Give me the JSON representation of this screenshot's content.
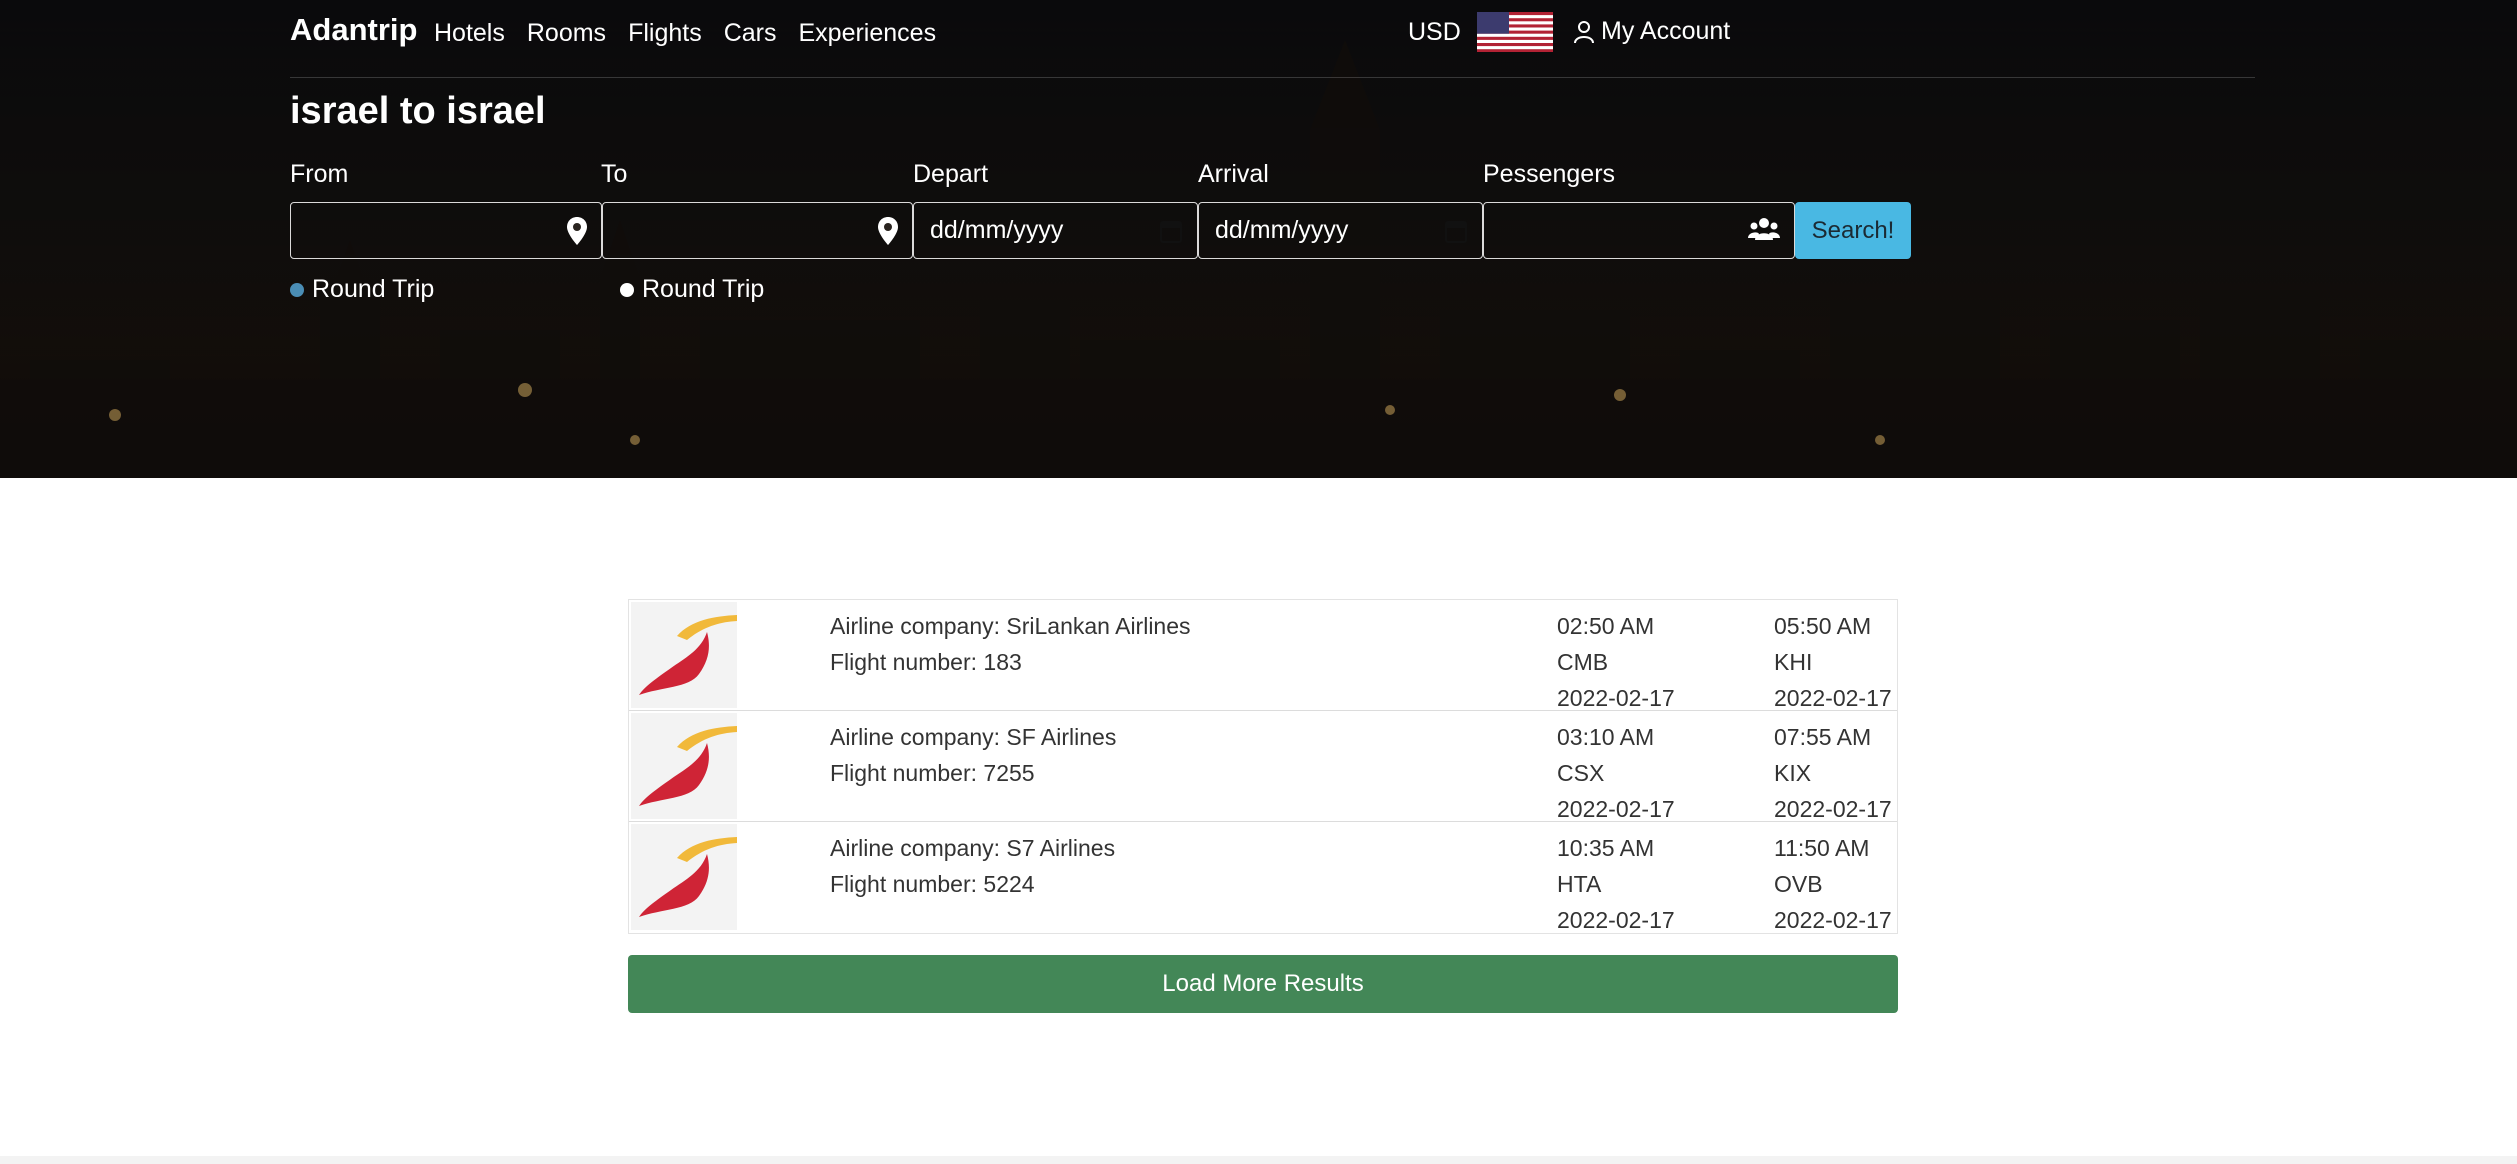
{
  "nav": {
    "brand": "Adantrip",
    "links": [
      "Hotels",
      "Rooms",
      "Flights",
      "Cars",
      "Experiences"
    ],
    "currency": "USD",
    "account": "My Account"
  },
  "search": {
    "title": "israel to israel",
    "labels": {
      "from": "From",
      "to": "To",
      "depart": "Depart",
      "arrival": "Arrival",
      "passengers": "Pessengers"
    },
    "depart_placeholder": "dd/mm/yyyy",
    "arrival_placeholder": "dd/mm/yyyy",
    "search_label": "Search!",
    "radio1": "Round Trip",
    "radio2": "Round Trip"
  },
  "results": [
    {
      "airline": "Airline company: SriLankan Airlines",
      "flight": "Flight number: 183",
      "dep_time": "02:50 AM",
      "dep_code": "CMB",
      "dep_date": "2022-02-17",
      "arr_time": "05:50 AM",
      "arr_code": "KHI",
      "arr_date": "2022-02-17"
    },
    {
      "airline": "Airline company: SF Airlines",
      "flight": "Flight number: 7255",
      "dep_time": "03:10 AM",
      "dep_code": "CSX",
      "dep_date": "2022-02-17",
      "arr_time": "07:55 AM",
      "arr_code": "KIX",
      "arr_date": "2022-02-17"
    },
    {
      "airline": "Airline company: S7 Airlines",
      "flight": "Flight number: 5224",
      "dep_time": "10:35 AM",
      "dep_code": "HTA",
      "dep_date": "2022-02-17",
      "arr_time": "11:50 AM",
      "arr_code": "OVB",
      "arr_date": "2022-02-17"
    }
  ],
  "load_more": "Load More Results",
  "colors": {
    "search_button": "#49b8e3",
    "load_button": "#438757",
    "radio_active": "#4a8db5"
  },
  "icons": {
    "from": "map-pin-icon",
    "to": "map-pin-icon",
    "depart": "calendar-icon",
    "arrival": "calendar-icon",
    "passengers": "users-icon",
    "account": "user-icon"
  }
}
